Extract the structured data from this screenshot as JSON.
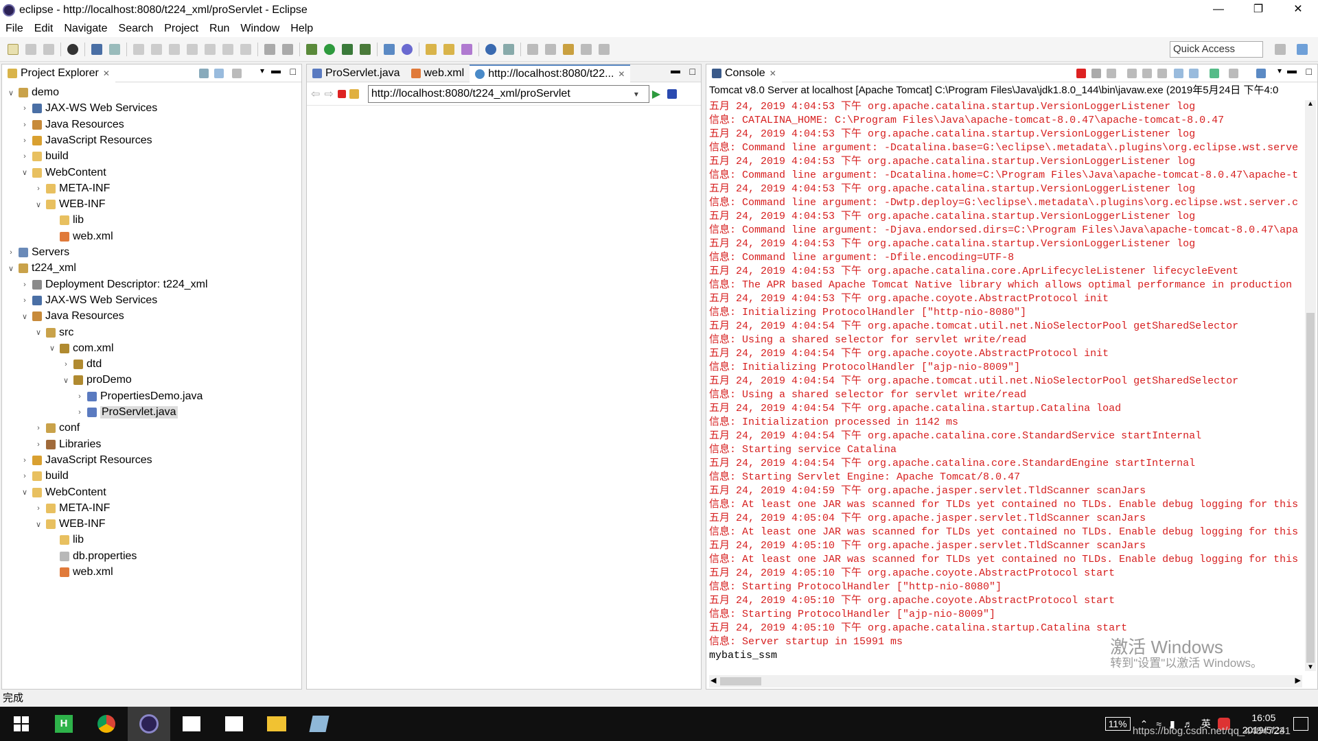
{
  "window": {
    "title": "eclipse - http://localhost:8080/t224_xml/proServlet - Eclipse"
  },
  "menu": [
    "File",
    "Edit",
    "Navigate",
    "Search",
    "Project",
    "Run",
    "Window",
    "Help"
  ],
  "toolbar": {
    "quick_access": "Quick Access"
  },
  "explorer": {
    "title": "Project Explorer",
    "tree": [
      {
        "depth": 0,
        "arrow": "v",
        "icon": "project-folder-icon",
        "label": "demo"
      },
      {
        "depth": 1,
        "arrow": ">",
        "icon": "web-services-icon",
        "label": "JAX-WS Web Services"
      },
      {
        "depth": 1,
        "arrow": ">",
        "icon": "java-resources-icon",
        "label": "Java Resources"
      },
      {
        "depth": 1,
        "arrow": ">",
        "icon": "js-resources-icon",
        "label": "JavaScript Resources"
      },
      {
        "depth": 1,
        "arrow": ">",
        "icon": "folder-icon",
        "label": "build"
      },
      {
        "depth": 1,
        "arrow": "v",
        "icon": "folder-icon",
        "label": "WebContent"
      },
      {
        "depth": 2,
        "arrow": ">",
        "icon": "folder-icon",
        "label": "META-INF"
      },
      {
        "depth": 2,
        "arrow": "v",
        "icon": "folder-icon",
        "label": "WEB-INF"
      },
      {
        "depth": 3,
        "arrow": "",
        "icon": "folder-icon",
        "label": "lib"
      },
      {
        "depth": 3,
        "arrow": "",
        "icon": "xml-file-icon",
        "label": "web.xml"
      },
      {
        "depth": 0,
        "arrow": ">",
        "icon": "servers-folder-icon",
        "label": "Servers"
      },
      {
        "depth": 0,
        "arrow": "v",
        "icon": "project-folder-icon",
        "label": "t224_xml"
      },
      {
        "depth": 1,
        "arrow": ">",
        "icon": "deployment-descriptor-icon",
        "label": "Deployment Descriptor: t224_xml"
      },
      {
        "depth": 1,
        "arrow": ">",
        "icon": "web-services-icon",
        "label": "JAX-WS Web Services"
      },
      {
        "depth": 1,
        "arrow": "v",
        "icon": "java-resources-icon",
        "label": "Java Resources"
      },
      {
        "depth": 2,
        "arrow": "v",
        "icon": "source-folder-icon",
        "label": "src"
      },
      {
        "depth": 3,
        "arrow": "v",
        "icon": "package-icon",
        "label": "com.xml"
      },
      {
        "depth": 4,
        "arrow": ">",
        "icon": "package-icon",
        "label": "dtd"
      },
      {
        "depth": 4,
        "arrow": "v",
        "icon": "package-icon",
        "label": "proDemo"
      },
      {
        "depth": 5,
        "arrow": ">",
        "icon": "java-file-icon",
        "label": "PropertiesDemo.java"
      },
      {
        "depth": 5,
        "arrow": ">",
        "icon": "java-file-icon",
        "label": "ProServlet.java",
        "selected": true
      },
      {
        "depth": 2,
        "arrow": ">",
        "icon": "source-folder-icon",
        "label": "conf"
      },
      {
        "depth": 2,
        "arrow": ">",
        "icon": "libraries-icon",
        "label": "Libraries"
      },
      {
        "depth": 1,
        "arrow": ">",
        "icon": "js-resources-icon",
        "label": "JavaScript Resources"
      },
      {
        "depth": 1,
        "arrow": ">",
        "icon": "folder-icon",
        "label": "build"
      },
      {
        "depth": 1,
        "arrow": "v",
        "icon": "folder-icon",
        "label": "WebContent"
      },
      {
        "depth": 2,
        "arrow": ">",
        "icon": "folder-icon",
        "label": "META-INF"
      },
      {
        "depth": 2,
        "arrow": "v",
        "icon": "folder-icon",
        "label": "WEB-INF"
      },
      {
        "depth": 3,
        "arrow": "",
        "icon": "folder-icon",
        "label": "lib"
      },
      {
        "depth": 3,
        "arrow": "",
        "icon": "file-icon",
        "label": "db.properties"
      },
      {
        "depth": 3,
        "arrow": "",
        "icon": "xml-file-icon",
        "label": "web.xml"
      }
    ]
  },
  "editor": {
    "tabs": [
      "ProServlet.java",
      "web.xml",
      "http://localhost:8080/t22..."
    ],
    "url": "http://localhost:8080/t224_xml/proServlet"
  },
  "console": {
    "title": "Console",
    "header": "Tomcat v8.0 Server at localhost [Apache Tomcat] C:\\Program Files\\Java\\jdk1.8.0_144\\bin\\javaw.exe (2019年5月24日 下午4:0",
    "lines": [
      "五月 24, 2019 4:04:53 下午 org.apache.catalina.startup.VersionLoggerListener log",
      "信息: CATALINA_HOME:         C:\\Program Files\\Java\\apache-tomcat-8.0.47\\apache-tomcat-8.0.47",
      "五月 24, 2019 4:04:53 下午 org.apache.catalina.startup.VersionLoggerListener log",
      "信息: Command line argument: -Dcatalina.base=G:\\eclipse\\.metadata\\.plugins\\org.eclipse.wst.serve",
      "五月 24, 2019 4:04:53 下午 org.apache.catalina.startup.VersionLoggerListener log",
      "信息: Command line argument: -Dcatalina.home=C:\\Program Files\\Java\\apache-tomcat-8.0.47\\apache-t",
      "五月 24, 2019 4:04:53 下午 org.apache.catalina.startup.VersionLoggerListener log",
      "信息: Command line argument: -Dwtp.deploy=G:\\eclipse\\.metadata\\.plugins\\org.eclipse.wst.server.c",
      "五月 24, 2019 4:04:53 下午 org.apache.catalina.startup.VersionLoggerListener log",
      "信息: Command line argument: -Djava.endorsed.dirs=C:\\Program Files\\Java\\apache-tomcat-8.0.47\\apa",
      "五月 24, 2019 4:04:53 下午 org.apache.catalina.startup.VersionLoggerListener log",
      "信息: Command line argument: -Dfile.encoding=UTF-8",
      "五月 24, 2019 4:04:53 下午 org.apache.catalina.core.AprLifecycleListener lifecycleEvent",
      "信息: The APR based Apache Tomcat Native library which allows optimal performance in production",
      "五月 24, 2019 4:04:53 下午 org.apache.coyote.AbstractProtocol init",
      "信息: Initializing ProtocolHandler [\"http-nio-8080\"]",
      "五月 24, 2019 4:04:54 下午 org.apache.tomcat.util.net.NioSelectorPool getSharedSelector",
      "信息: Using a shared selector for servlet write/read",
      "五月 24, 2019 4:04:54 下午 org.apache.coyote.AbstractProtocol init",
      "信息: Initializing ProtocolHandler [\"ajp-nio-8009\"]",
      "五月 24, 2019 4:04:54 下午 org.apache.tomcat.util.net.NioSelectorPool getSharedSelector",
      "信息: Using a shared selector for servlet write/read",
      "五月 24, 2019 4:04:54 下午 org.apache.catalina.startup.Catalina load",
      "信息: Initialization processed in 1142 ms",
      "五月 24, 2019 4:04:54 下午 org.apache.catalina.core.StandardService startInternal",
      "信息: Starting service Catalina",
      "五月 24, 2019 4:04:54 下午 org.apache.catalina.core.StandardEngine startInternal",
      "信息: Starting Servlet Engine: Apache Tomcat/8.0.47",
      "五月 24, 2019 4:04:59 下午 org.apache.jasper.servlet.TldScanner scanJars",
      "信息: At least one JAR was scanned for TLDs yet contained no TLDs. Enable debug logging for this",
      "五月 24, 2019 4:05:04 下午 org.apache.jasper.servlet.TldScanner scanJars",
      "信息: At least one JAR was scanned for TLDs yet contained no TLDs. Enable debug logging for this",
      "五月 24, 2019 4:05:10 下午 org.apache.jasper.servlet.TldScanner scanJars",
      "信息: At least one JAR was scanned for TLDs yet contained no TLDs. Enable debug logging for this",
      "五月 24, 2019 4:05:10 下午 org.apache.coyote.AbstractProtocol start",
      "信息: Starting ProtocolHandler [\"http-nio-8080\"]",
      "五月 24, 2019 4:05:10 下午 org.apache.coyote.AbstractProtocol start",
      "信息: Starting ProtocolHandler [\"ajp-nio-8009\"]",
      "五月 24, 2019 4:05:10 下午 org.apache.catalina.startup.Catalina start",
      "信息: Server startup in 15991 ms"
    ],
    "stdout_line": "mybatis_ssm"
  },
  "watermark": {
    "line1": "激活 Windows",
    "line2": "转到\"设置\"以激活 Windows。"
  },
  "status": {
    "text": "完成"
  },
  "taskbar": {
    "battery": "11%",
    "ime": "英",
    "time": "16:05",
    "date": "2019/5/24",
    "blog_overlay": "https://blog.csdn.net/qq_44847231"
  },
  "colors": {
    "log_red": "#d61e1e",
    "taskbar": "#101010"
  }
}
